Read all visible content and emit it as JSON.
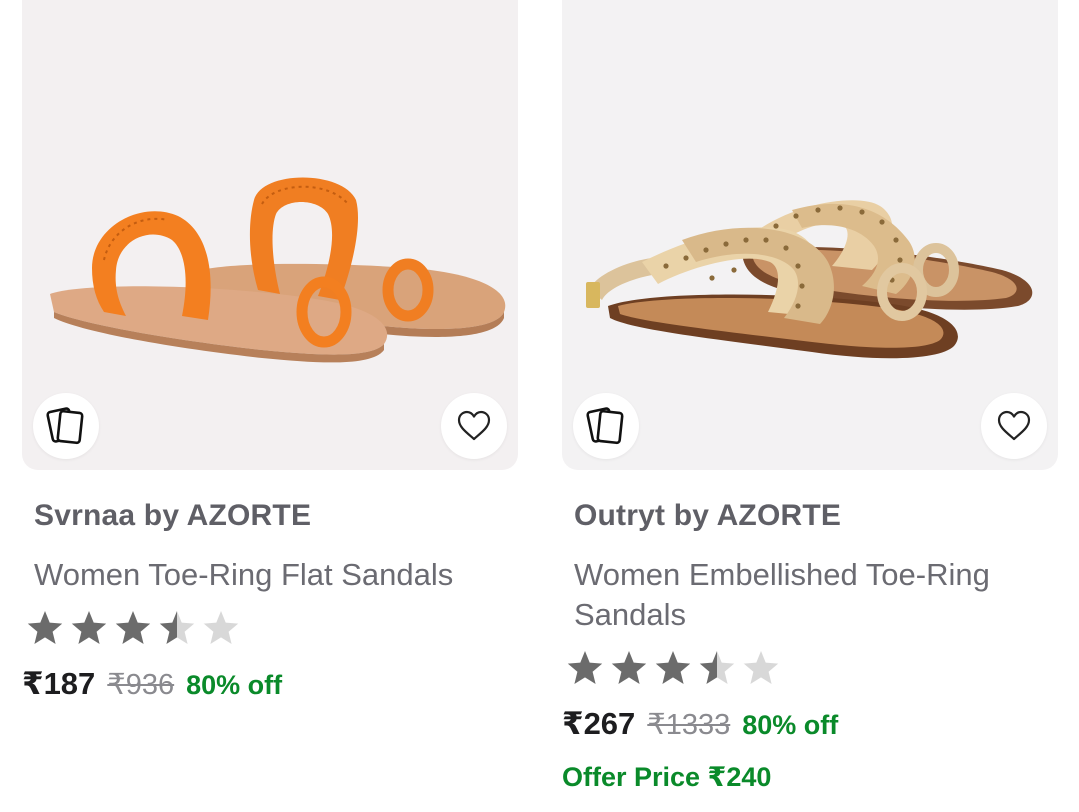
{
  "products": [
    {
      "brand": "Svrnaa by AZORTE",
      "title": "Women Toe-Ring Flat Sandals",
      "rating": 3.5,
      "price": "₹187",
      "mrp": "₹936",
      "discount": "80% off",
      "icons": [
        "similar-cards-icon",
        "heart-icon"
      ],
      "image": "orange-toe-ring-sandals"
    },
    {
      "brand": "Outryt by AZORTE",
      "title": "Women Embellished Toe-Ring Sandals",
      "rating": 3.5,
      "price": "₹267",
      "mrp": "₹1333",
      "discount": "80% off",
      "offer_price": "Offer Price ₹240",
      "icons": [
        "similar-cards-icon",
        "heart-icon"
      ],
      "image": "beige-studded-sandals"
    }
  ],
  "colors": {
    "star_filled": "#6b6b6b",
    "star_empty": "#d8d8d8",
    "discount_green": "#0a8a2a"
  }
}
